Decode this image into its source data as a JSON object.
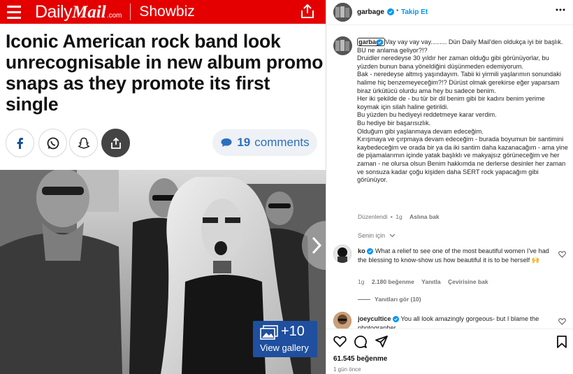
{
  "article": {
    "logo_daily": "Daily",
    "logo_mail": "Mail",
    "logo_com": ".com",
    "section": "Showbiz",
    "headline_lines": [
      "Iconic American rock band look",
      "unrecognisable in new album promo",
      "snaps as they promote its first",
      "single"
    ],
    "comments_count": "19",
    "comments_label": "comments",
    "gallery_count": "+10",
    "gallery_label": "View gallery"
  },
  "post": {
    "author": "garbage",
    "follow_label": "Takip Et",
    "caption_lines": [
      " Vay vay vay vay......... Dün Daily Mail'den oldukça iyi bir başlık.",
      "BU ne anlama geliyor?!?",
      "Druidler neredeyse 30 yıldır her zaman olduğu gibi görünüyorlar, bu yüzden bunun bana yöneldiğini düşünmeden edemiyorum.",
      "Bak - neredeyse altmış yaşındayım. Tabii ki yirmili yaşlarımın sonundaki halime hiç benzemeyeceğim?!? Dürüst olmak gerekirse eğer yaparsam biraz ürkütücü olurdu ama hey bu sadece benim.",
      "Her iki şekilde de - bu tür bir dil benim gibi bir kadını benim yerime koymak için silah haline getirildi.",
      "Bu yüzden bu hediyeyi reddetmeye karar verdim.",
      "Bu hediye bir başarısızlık.",
      "Olduğum gibi yaşlanmaya devam edeceğim.",
      "Kırışmaya ve çırpmaya devam edeceğim - burada boyumun bir santimini kaybedeceğim ve orada bir ya da iki santim daha kazanacağım - ama yine de pijamalarımın içinde yatak başlıklı ve makyajsız görüneceğim ve her zaman - ne olursa olsun Benim hakkımda ne derlerse desinler her zaman ve sonsuza kadar çoğu kişiden daha SERT rock yapacağım gibi görünüyor."
    ],
    "edited_label": "Düzenlendi",
    "edited_time": "1g",
    "see_original": "Aslına bak",
    "for_you": "Senin için",
    "likes": "61.545 beğenme",
    "posted_ago": "1 gün önce"
  },
  "comments": [
    {
      "user": "ko",
      "text": "What a relief to see one of the most beautiful women I've had the blessing to know-show us how beautiful it is to be herself 🙌",
      "time": "1g",
      "likes": "2.180 beğenme",
      "reply": "Yanıtla",
      "translate": "Çevirisine bak",
      "view_replies": "Yanıtları gör (10)"
    },
    {
      "user": "joeycultice",
      "text": "You all look amazingly gorgeous- but I blame the photographer"
    }
  ],
  "colors": {
    "dm_red": "#e40000",
    "link_blue": "#0095f6",
    "gallery_blue": "#1f4f9e",
    "comments_blue": "#2a6fbd"
  }
}
